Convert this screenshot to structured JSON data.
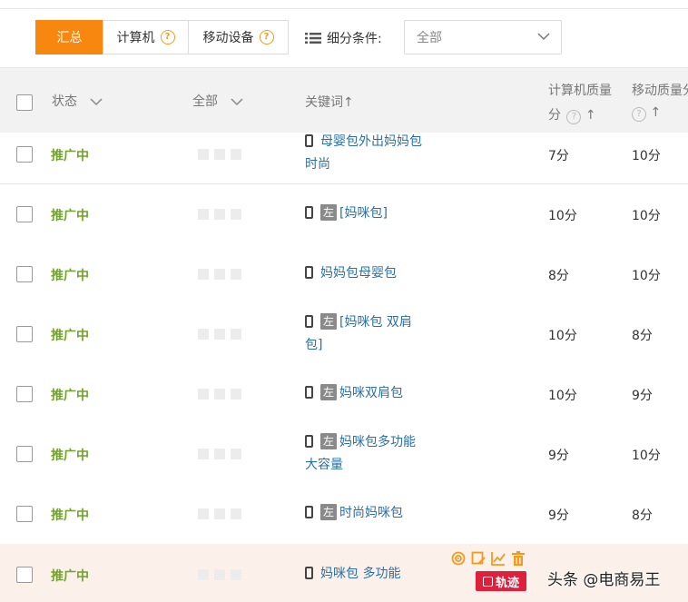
{
  "tabs": [
    {
      "label": "汇总",
      "active": true
    },
    {
      "label": "计算机",
      "help": "?"
    },
    {
      "label": "移动设备",
      "help": "?"
    }
  ],
  "filter": {
    "label": "细分条件:",
    "value": "全部"
  },
  "header": {
    "status": "状态",
    "all": "全部",
    "keyword": "关键词↑",
    "pc_quality_line1": "计算机质量",
    "pc_quality_line2": "分",
    "mobile_quality_line1": "移动质量分",
    "arrow": "↑",
    "help": "?"
  },
  "rows": [
    {
      "status": "推广中",
      "tag": "",
      "keyword": "母婴包外出妈妈包 时尚",
      "pc": "7分",
      "mobile": "10分"
    },
    {
      "status": "推广中",
      "tag": "左",
      "keyword": "[妈咪包]",
      "pc": "10分",
      "mobile": "10分"
    },
    {
      "status": "推广中",
      "tag": "",
      "keyword": "妈妈包母婴包",
      "pc": "8分",
      "mobile": "10分"
    },
    {
      "status": "推广中",
      "tag": "左",
      "keyword": "[妈咪包 双肩包]",
      "pc": "10分",
      "mobile": "8分"
    },
    {
      "status": "推广中",
      "tag": "左",
      "keyword": "妈咪双肩包",
      "pc": "10分",
      "mobile": "9分"
    },
    {
      "status": "推广中",
      "tag": "左",
      "keyword": "妈咪包多功能大容量",
      "pc": "9分",
      "mobile": "10分"
    },
    {
      "status": "推广中",
      "tag": "左",
      "keyword": "时尚妈咪包",
      "pc": "9分",
      "mobile": "8分"
    },
    {
      "status": "推广中",
      "tag": "",
      "keyword": "妈咪包 多功能",
      "pc": "",
      "mobile": ""
    }
  ],
  "row_actions": {
    "trace_label": "轨迹"
  },
  "watermark": "头条 @电商易王",
  "colors": {
    "accent": "#f7870e",
    "status_green": "#72a32c",
    "link_blue": "#2a6fa8",
    "trace_red": "#e01f3d"
  },
  "icons": [
    "list-icon",
    "chevron-down-icon",
    "help-icon",
    "phone-icon",
    "target-icon",
    "edit-icon",
    "chart-icon",
    "trash-icon"
  ]
}
